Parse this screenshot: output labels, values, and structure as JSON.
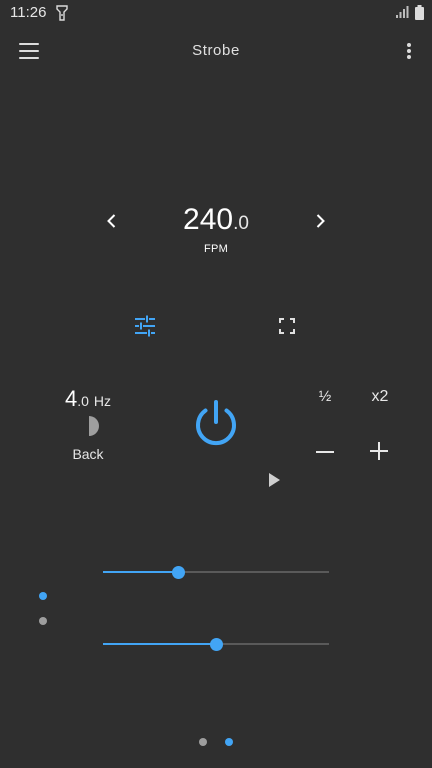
{
  "status_bar": {
    "time": "11:26"
  },
  "toolbar": {
    "title": "Strobe"
  },
  "rate": {
    "integer": "240",
    "decimal": ".0",
    "unit": "FPM"
  },
  "frequency": {
    "integer": "4",
    "decimal": ".0",
    "unit": "Hz"
  },
  "phase": {
    "label": "Back"
  },
  "multiplier": {
    "half_label": "½",
    "double_label": "x2"
  },
  "sliders": [
    {
      "level": 0.33
    },
    {
      "level": 0.5
    }
  ],
  "side_indicator": {
    "active_index": 0
  },
  "pager": {
    "active_index": 1,
    "count": 2
  },
  "colors": {
    "accent": "#42a5f5",
    "background": "#2f2f2f",
    "text": "#e8e8e8",
    "inactive": "#9e9e9e"
  }
}
